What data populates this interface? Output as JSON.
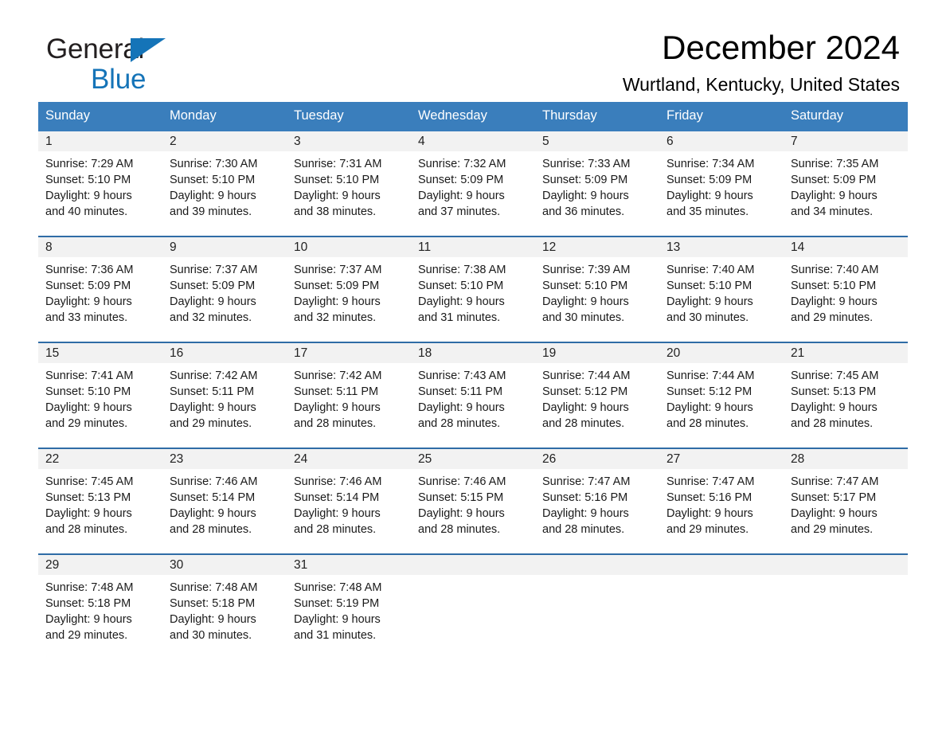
{
  "brand": {
    "name_part1": "General",
    "name_part2": "Blue",
    "logo_icon": "triangle-logo-icon",
    "accent_color": "#1574b8"
  },
  "header": {
    "month_title": "December 2024",
    "location": "Wurtland, Kentucky, United States"
  },
  "calendar": {
    "header_bg_color": "#3a7ebc",
    "row_divider_color": "#2f6ca6",
    "daynum_band_color": "#f2f2f2",
    "weekday_headers": [
      "Sunday",
      "Monday",
      "Tuesday",
      "Wednesday",
      "Thursday",
      "Friday",
      "Saturday"
    ],
    "weeks": [
      [
        {
          "day": "1",
          "sunrise": "Sunrise: 7:29 AM",
          "sunset": "Sunset: 5:10 PM",
          "daylight_line1": "Daylight: 9 hours",
          "daylight_line2": "and 40 minutes."
        },
        {
          "day": "2",
          "sunrise": "Sunrise: 7:30 AM",
          "sunset": "Sunset: 5:10 PM",
          "daylight_line1": "Daylight: 9 hours",
          "daylight_line2": "and 39 minutes."
        },
        {
          "day": "3",
          "sunrise": "Sunrise: 7:31 AM",
          "sunset": "Sunset: 5:10 PM",
          "daylight_line1": "Daylight: 9 hours",
          "daylight_line2": "and 38 minutes."
        },
        {
          "day": "4",
          "sunrise": "Sunrise: 7:32 AM",
          "sunset": "Sunset: 5:09 PM",
          "daylight_line1": "Daylight: 9 hours",
          "daylight_line2": "and 37 minutes."
        },
        {
          "day": "5",
          "sunrise": "Sunrise: 7:33 AM",
          "sunset": "Sunset: 5:09 PM",
          "daylight_line1": "Daylight: 9 hours",
          "daylight_line2": "and 36 minutes."
        },
        {
          "day": "6",
          "sunrise": "Sunrise: 7:34 AM",
          "sunset": "Sunset: 5:09 PM",
          "daylight_line1": "Daylight: 9 hours",
          "daylight_line2": "and 35 minutes."
        },
        {
          "day": "7",
          "sunrise": "Sunrise: 7:35 AM",
          "sunset": "Sunset: 5:09 PM",
          "daylight_line1": "Daylight: 9 hours",
          "daylight_line2": "and 34 minutes."
        }
      ],
      [
        {
          "day": "8",
          "sunrise": "Sunrise: 7:36 AM",
          "sunset": "Sunset: 5:09 PM",
          "daylight_line1": "Daylight: 9 hours",
          "daylight_line2": "and 33 minutes."
        },
        {
          "day": "9",
          "sunrise": "Sunrise: 7:37 AM",
          "sunset": "Sunset: 5:09 PM",
          "daylight_line1": "Daylight: 9 hours",
          "daylight_line2": "and 32 minutes."
        },
        {
          "day": "10",
          "sunrise": "Sunrise: 7:37 AM",
          "sunset": "Sunset: 5:09 PM",
          "daylight_line1": "Daylight: 9 hours",
          "daylight_line2": "and 32 minutes."
        },
        {
          "day": "11",
          "sunrise": "Sunrise: 7:38 AM",
          "sunset": "Sunset: 5:10 PM",
          "daylight_line1": "Daylight: 9 hours",
          "daylight_line2": "and 31 minutes."
        },
        {
          "day": "12",
          "sunrise": "Sunrise: 7:39 AM",
          "sunset": "Sunset: 5:10 PM",
          "daylight_line1": "Daylight: 9 hours",
          "daylight_line2": "and 30 minutes."
        },
        {
          "day": "13",
          "sunrise": "Sunrise: 7:40 AM",
          "sunset": "Sunset: 5:10 PM",
          "daylight_line1": "Daylight: 9 hours",
          "daylight_line2": "and 30 minutes."
        },
        {
          "day": "14",
          "sunrise": "Sunrise: 7:40 AM",
          "sunset": "Sunset: 5:10 PM",
          "daylight_line1": "Daylight: 9 hours",
          "daylight_line2": "and 29 minutes."
        }
      ],
      [
        {
          "day": "15",
          "sunrise": "Sunrise: 7:41 AM",
          "sunset": "Sunset: 5:10 PM",
          "daylight_line1": "Daylight: 9 hours",
          "daylight_line2": "and 29 minutes."
        },
        {
          "day": "16",
          "sunrise": "Sunrise: 7:42 AM",
          "sunset": "Sunset: 5:11 PM",
          "daylight_line1": "Daylight: 9 hours",
          "daylight_line2": "and 29 minutes."
        },
        {
          "day": "17",
          "sunrise": "Sunrise: 7:42 AM",
          "sunset": "Sunset: 5:11 PM",
          "daylight_line1": "Daylight: 9 hours",
          "daylight_line2": "and 28 minutes."
        },
        {
          "day": "18",
          "sunrise": "Sunrise: 7:43 AM",
          "sunset": "Sunset: 5:11 PM",
          "daylight_line1": "Daylight: 9 hours",
          "daylight_line2": "and 28 minutes."
        },
        {
          "day": "19",
          "sunrise": "Sunrise: 7:44 AM",
          "sunset": "Sunset: 5:12 PM",
          "daylight_line1": "Daylight: 9 hours",
          "daylight_line2": "and 28 minutes."
        },
        {
          "day": "20",
          "sunrise": "Sunrise: 7:44 AM",
          "sunset": "Sunset: 5:12 PM",
          "daylight_line1": "Daylight: 9 hours",
          "daylight_line2": "and 28 minutes."
        },
        {
          "day": "21",
          "sunrise": "Sunrise: 7:45 AM",
          "sunset": "Sunset: 5:13 PM",
          "daylight_line1": "Daylight: 9 hours",
          "daylight_line2": "and 28 minutes."
        }
      ],
      [
        {
          "day": "22",
          "sunrise": "Sunrise: 7:45 AM",
          "sunset": "Sunset: 5:13 PM",
          "daylight_line1": "Daylight: 9 hours",
          "daylight_line2": "and 28 minutes."
        },
        {
          "day": "23",
          "sunrise": "Sunrise: 7:46 AM",
          "sunset": "Sunset: 5:14 PM",
          "daylight_line1": "Daylight: 9 hours",
          "daylight_line2": "and 28 minutes."
        },
        {
          "day": "24",
          "sunrise": "Sunrise: 7:46 AM",
          "sunset": "Sunset: 5:14 PM",
          "daylight_line1": "Daylight: 9 hours",
          "daylight_line2": "and 28 minutes."
        },
        {
          "day": "25",
          "sunrise": "Sunrise: 7:46 AM",
          "sunset": "Sunset: 5:15 PM",
          "daylight_line1": "Daylight: 9 hours",
          "daylight_line2": "and 28 minutes."
        },
        {
          "day": "26",
          "sunrise": "Sunrise: 7:47 AM",
          "sunset": "Sunset: 5:16 PM",
          "daylight_line1": "Daylight: 9 hours",
          "daylight_line2": "and 28 minutes."
        },
        {
          "day": "27",
          "sunrise": "Sunrise: 7:47 AM",
          "sunset": "Sunset: 5:16 PM",
          "daylight_line1": "Daylight: 9 hours",
          "daylight_line2": "and 29 minutes."
        },
        {
          "day": "28",
          "sunrise": "Sunrise: 7:47 AM",
          "sunset": "Sunset: 5:17 PM",
          "daylight_line1": "Daylight: 9 hours",
          "daylight_line2": "and 29 minutes."
        }
      ],
      [
        {
          "day": "29",
          "sunrise": "Sunrise: 7:48 AM",
          "sunset": "Sunset: 5:18 PM",
          "daylight_line1": "Daylight: 9 hours",
          "daylight_line2": "and 29 minutes."
        },
        {
          "day": "30",
          "sunrise": "Sunrise: 7:48 AM",
          "sunset": "Sunset: 5:18 PM",
          "daylight_line1": "Daylight: 9 hours",
          "daylight_line2": "and 30 minutes."
        },
        {
          "day": "31",
          "sunrise": "Sunrise: 7:48 AM",
          "sunset": "Sunset: 5:19 PM",
          "daylight_line1": "Daylight: 9 hours",
          "daylight_line2": "and 31 minutes."
        },
        {
          "day": "",
          "sunrise": "",
          "sunset": "",
          "daylight_line1": "",
          "daylight_line2": ""
        },
        {
          "day": "",
          "sunrise": "",
          "sunset": "",
          "daylight_line1": "",
          "daylight_line2": ""
        },
        {
          "day": "",
          "sunrise": "",
          "sunset": "",
          "daylight_line1": "",
          "daylight_line2": ""
        },
        {
          "day": "",
          "sunrise": "",
          "sunset": "",
          "daylight_line1": "",
          "daylight_line2": ""
        }
      ]
    ]
  }
}
